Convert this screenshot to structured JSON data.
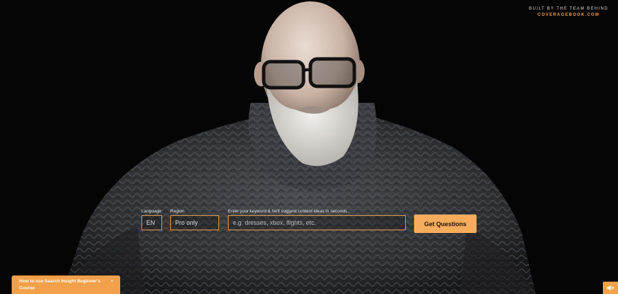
{
  "header": {
    "credit_line1": "BUILT BY THE TEAM BEHIND",
    "credit_line2": "COVERAGEBOOK.COM"
  },
  "search_form": {
    "language": {
      "label": "Language",
      "value": "EN"
    },
    "region": {
      "label": "Region",
      "value": "Pro only"
    },
    "keyword": {
      "label": "Enter your keyword & he'll suggest content ideas in seconds...",
      "placeholder": "e.g. dresses, xbox, flights, etc."
    },
    "submit_label": "Get Questions"
  },
  "course_bar": {
    "label": "How to use Search Insight Beginner's Course",
    "icon": "chevron-up-icon"
  },
  "mute_button": {
    "icon": "speaker-mute-icon"
  },
  "colors": {
    "accent": "#f4a24a",
    "background": "#050505",
    "input_border": "#e79a4b"
  }
}
